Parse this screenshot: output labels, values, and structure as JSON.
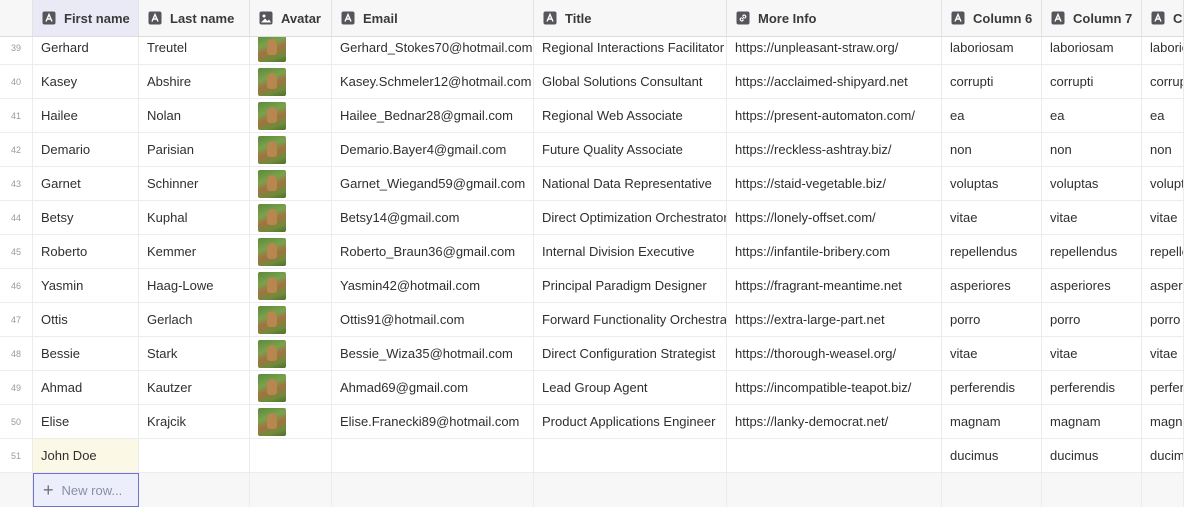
{
  "header": {
    "columns": [
      {
        "label": "",
        "icon": ""
      },
      {
        "label": "First name",
        "icon": "text-type-icon"
      },
      {
        "label": "Last name",
        "icon": "text-type-icon"
      },
      {
        "label": "Avatar",
        "icon": "image-type-icon"
      },
      {
        "label": "Email",
        "icon": "text-type-icon"
      },
      {
        "label": "Title",
        "icon": "text-type-icon"
      },
      {
        "label": "More Info",
        "icon": "link-type-icon"
      },
      {
        "label": "Column 6",
        "icon": "text-type-icon"
      },
      {
        "label": "Column 7",
        "icon": "text-type-icon"
      },
      {
        "label": "Co",
        "icon": "text-type-icon"
      }
    ]
  },
  "rows": [
    {
      "num": "39",
      "first": "Gerhard",
      "last": "Treutel",
      "email": "Gerhard_Stokes70@hotmail.com",
      "title": "Regional Interactions Facilitator",
      "info": "https://unpleasant-straw.org/",
      "c6": "laboriosam",
      "c7": "laboriosam",
      "c8": "laboriosam"
    },
    {
      "num": "40",
      "first": "Kasey",
      "last": "Abshire",
      "email": "Kasey.Schmeler12@hotmail.com",
      "title": "Global Solutions Consultant",
      "info": "https://acclaimed-shipyard.net",
      "c6": "corrupti",
      "c7": "corrupti",
      "c8": "corrupti"
    },
    {
      "num": "41",
      "first": "Hailee",
      "last": "Nolan",
      "email": "Hailee_Bednar28@gmail.com",
      "title": "Regional Web Associate",
      "info": "https://present-automaton.com/",
      "c6": "ea",
      "c7": "ea",
      "c8": "ea"
    },
    {
      "num": "42",
      "first": "Demario",
      "last": "Parisian",
      "email": "Demario.Bayer4@gmail.com",
      "title": "Future Quality Associate",
      "info": "https://reckless-ashtray.biz/",
      "c6": "non",
      "c7": "non",
      "c8": "non"
    },
    {
      "num": "43",
      "first": "Garnet",
      "last": "Schinner",
      "email": "Garnet_Wiegand59@gmail.com",
      "title": "National Data Representative",
      "info": "https://staid-vegetable.biz/",
      "c6": "voluptas",
      "c7": "voluptas",
      "c8": "voluptas"
    },
    {
      "num": "44",
      "first": "Betsy",
      "last": "Kuphal",
      "email": "Betsy14@gmail.com",
      "title": "Direct Optimization Orchestrator",
      "info": "https://lonely-offset.com/",
      "c6": "vitae",
      "c7": "vitae",
      "c8": "vitae"
    },
    {
      "num": "45",
      "first": "Roberto",
      "last": "Kemmer",
      "email": "Roberto_Braun36@gmail.com",
      "title": "Internal Division Executive",
      "info": "https://infantile-bribery.com",
      "c6": "repellendus",
      "c7": "repellendus",
      "c8": "repellendus"
    },
    {
      "num": "46",
      "first": "Yasmin",
      "last": "Haag-Lowe",
      "email": "Yasmin42@hotmail.com",
      "title": "Principal Paradigm Designer",
      "info": "https://fragrant-meantime.net",
      "c6": "asperiores",
      "c7": "asperiores",
      "c8": "asperiores"
    },
    {
      "num": "47",
      "first": "Ottis",
      "last": "Gerlach",
      "email": "Ottis91@hotmail.com",
      "title": "Forward Functionality Orchestrator",
      "info": "https://extra-large-part.net",
      "c6": "porro",
      "c7": "porro",
      "c8": "porro"
    },
    {
      "num": "48",
      "first": "Bessie",
      "last": "Stark",
      "email": "Bessie_Wiza35@hotmail.com",
      "title": "Direct Configuration Strategist",
      "info": "https://thorough-weasel.org/",
      "c6": "vitae",
      "c7": "vitae",
      "c8": "vitae"
    },
    {
      "num": "49",
      "first": "Ahmad",
      "last": "Kautzer",
      "email": "Ahmad69@gmail.com",
      "title": "Lead Group Agent",
      "info": "https://incompatible-teapot.biz/",
      "c6": "perferendis",
      "c7": "perferendis",
      "c8": "perferendis"
    },
    {
      "num": "50",
      "first": "Elise",
      "last": "Krajcik",
      "email": "Elise.Franecki89@hotmail.com",
      "title": "Product Applications Engineer",
      "info": "https://lanky-democrat.net/",
      "c6": "magnam",
      "c7": "magnam",
      "c8": "magnam"
    },
    {
      "num": "51",
      "first": "John Doe",
      "last": "",
      "email": "",
      "title": "",
      "info": "",
      "c6": "ducimus",
      "c7": "ducimus",
      "c8": "ducimus",
      "no_avatar": true
    }
  ],
  "new_row": {
    "label": "New row..."
  }
}
